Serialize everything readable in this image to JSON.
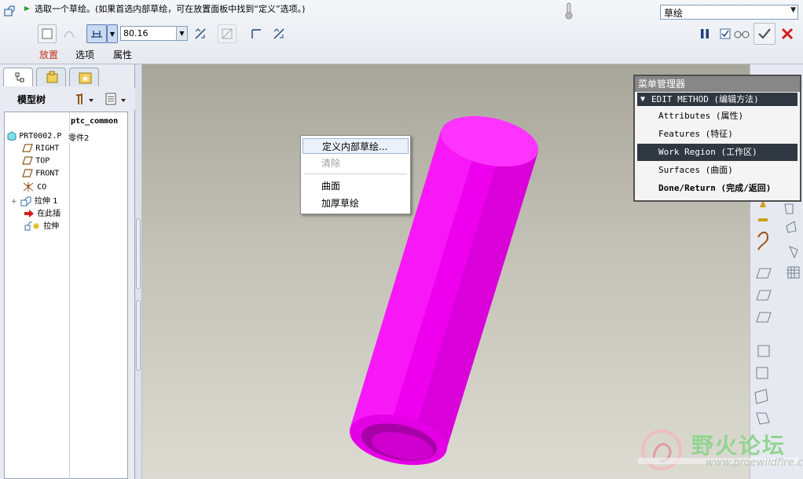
{
  "prompt": {
    "text": "选取一个草绘。(如果首选内部草绘，可在放置面板中找到“定义”选项。)"
  },
  "mode_select": {
    "value": "草绘"
  },
  "dashboard": {
    "dimension_value": "80.16",
    "tabs": {
      "place": "放置",
      "options": "选项",
      "properties": "属性"
    }
  },
  "model_tree": {
    "title": "模型树",
    "column_header": "ptc_common",
    "items": [
      {
        "label": "PRT0002.P",
        "column_value": "零件2",
        "icon": "part-icon"
      },
      {
        "label": "RIGHT",
        "icon": "datum-plane-icon"
      },
      {
        "label": "TOP",
        "icon": "datum-plane-icon"
      },
      {
        "label": "FRONT",
        "icon": "datum-plane-icon"
      },
      {
        "label": "CO",
        "icon": "coordinate-system-icon"
      },
      {
        "label": "拉伸 1",
        "icon": "extrude-icon"
      },
      {
        "label": "在此插",
        "icon": "insert-here-icon"
      },
      {
        "label": "拉伸",
        "icon": "extrude-new-icon"
      }
    ]
  },
  "context_menu": {
    "items": [
      {
        "label": "定义内部草绘...",
        "enabled": true,
        "highlighted": true
      },
      {
        "label": "清除",
        "enabled": false
      },
      {
        "label": "曲面",
        "enabled": true
      },
      {
        "label": "加厚草绘",
        "enabled": true
      }
    ]
  },
  "menu_manager": {
    "title": "菜单管理器",
    "header": "EDIT METHOD (编辑方法)",
    "items": [
      {
        "label": "Attributes (属性)"
      },
      {
        "label": "Features (特征)"
      },
      {
        "label": "Work Region (工作区)",
        "selected": true
      },
      {
        "label": "Surfaces (曲面)"
      },
      {
        "label": "Done/Return (完成/返回)",
        "bold": true
      }
    ]
  },
  "watermark": {
    "text": "野火论坛",
    "url": "www.proewildfire.cn"
  },
  "colors": {
    "model": "#ff00ff",
    "accent_tab": "#c0301a",
    "selection_dark": "#2f3740"
  }
}
